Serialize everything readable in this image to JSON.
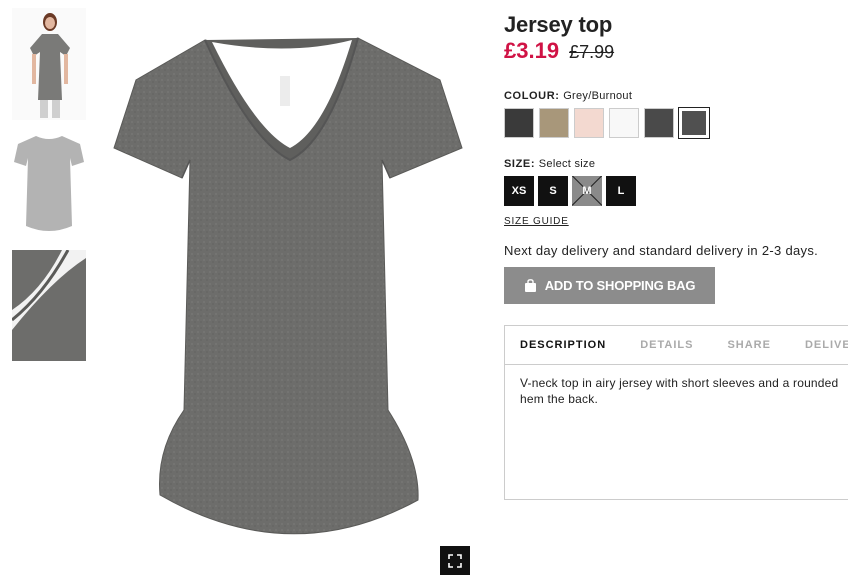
{
  "product": {
    "title": "Jersey top",
    "price_now": "£3.19",
    "price_old": "£7.99"
  },
  "colour": {
    "label": "COLOUR:",
    "selected": "Grey/Burnout",
    "swatches": [
      {
        "name": "black",
        "color": "#3a3a3a"
      },
      {
        "name": "beige",
        "color": "#a8977a"
      },
      {
        "name": "light-pink",
        "color": "#f3d9d0"
      },
      {
        "name": "white",
        "color": "#f8f8f8"
      },
      {
        "name": "dark-grey",
        "color": "#4a4a4a"
      },
      {
        "name": "grey-burnout",
        "color": "#505050"
      }
    ]
  },
  "size": {
    "label": "SIZE:",
    "selected": "Select size",
    "options": [
      "XS",
      "S",
      "M",
      "L"
    ],
    "unavailable": [
      "M"
    ],
    "guide_link": "SIZE GUIDE"
  },
  "delivery_text": "Next day delivery and standard delivery in 2-3 days.",
  "add_button_label": "ADD TO SHOPPING BAG",
  "tabs": [
    "DESCRIPTION",
    "DETAILS",
    "SHARE",
    "DELIVER"
  ],
  "active_tab": "DESCRIPTION",
  "description": "V-neck top in airy jersey with short sleeves and a rounded hem the back.",
  "icons": {
    "bag": "shopping-bag-icon",
    "zoom": "fullscreen-icon"
  },
  "colors": {
    "sale_red": "#d01345",
    "button_grey": "#8c8c8c",
    "garment_grey": "#6b6b69"
  }
}
